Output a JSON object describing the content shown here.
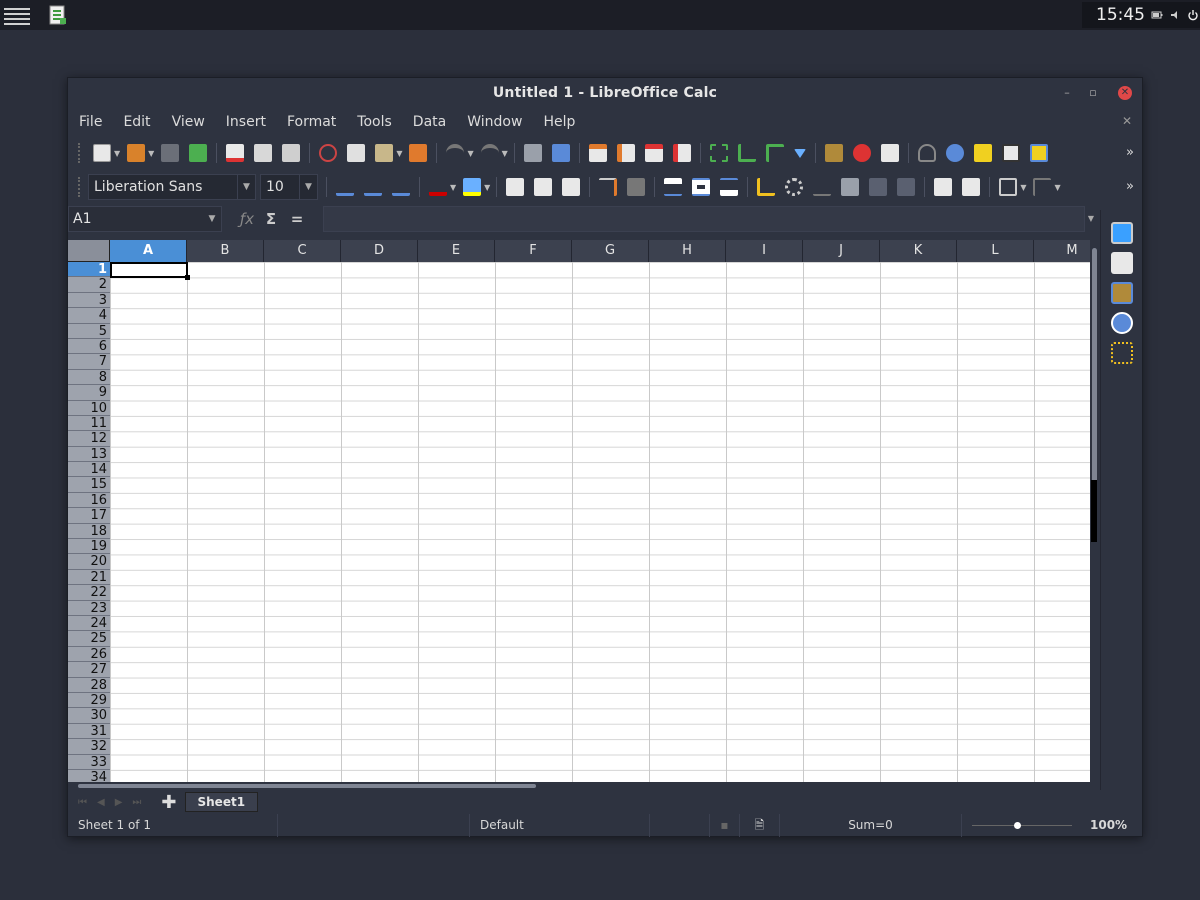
{
  "panel": {
    "clock": "15:45"
  },
  "window": {
    "title": "Untitled 1 - LibreOffice Calc"
  },
  "menubar": {
    "items": [
      {
        "label": "File"
      },
      {
        "label": "Edit"
      },
      {
        "label": "View"
      },
      {
        "label": "Insert"
      },
      {
        "label": "Format"
      },
      {
        "label": "Tools"
      },
      {
        "label": "Data"
      },
      {
        "label": "Window"
      },
      {
        "label": "Help"
      }
    ]
  },
  "formatting": {
    "font_name": "Liberation Sans",
    "font_size": "10"
  },
  "formula_bar": {
    "name_box": "A1",
    "formula": ""
  },
  "grid": {
    "columns": [
      "A",
      "B",
      "C",
      "D",
      "E",
      "F",
      "G",
      "H",
      "I",
      "J",
      "K",
      "L",
      "M"
    ],
    "rows": [
      "1",
      "2",
      "3",
      "4",
      "5",
      "6",
      "7",
      "8",
      "9",
      "10",
      "11",
      "12",
      "13",
      "14",
      "15",
      "16",
      "17",
      "18",
      "19",
      "20",
      "21",
      "22",
      "23",
      "24",
      "25",
      "26",
      "27",
      "28",
      "29",
      "30",
      "31",
      "32",
      "33",
      "34"
    ],
    "active_column": "A",
    "active_row": "1"
  },
  "sheet_tabs": {
    "tabs": [
      "Sheet1"
    ]
  },
  "status_bar": {
    "sheet_info": "Sheet 1 of 1",
    "page_style": "Default",
    "sum": "Sum=0",
    "zoom": "100%"
  },
  "colors": {
    "accent": "#4a8fd6",
    "close_button": "#e04848",
    "window_bg": "#2e3340",
    "desktop_bg": "#2b2f3b"
  }
}
